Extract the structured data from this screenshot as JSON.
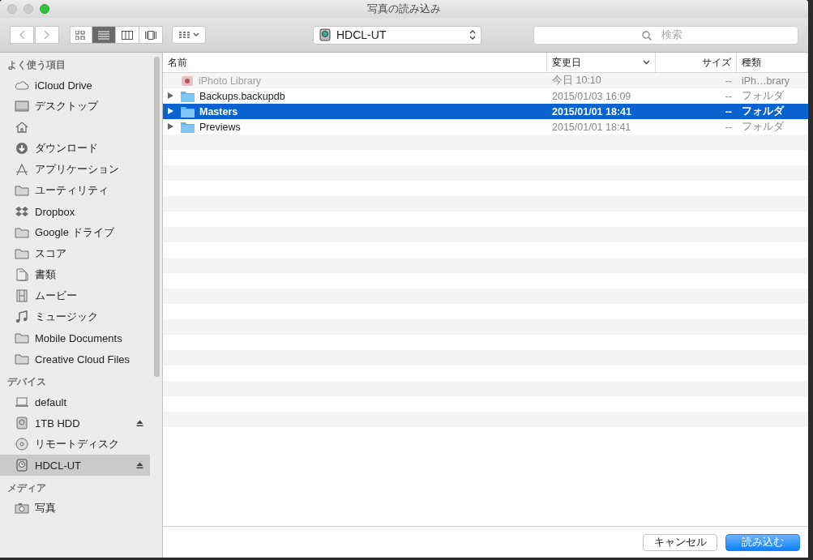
{
  "window": {
    "title": "写真の読み込み"
  },
  "toolbar": {
    "view_modes": [
      {
        "kind": "icons",
        "selected": false
      },
      {
        "kind": "list",
        "selected": true
      },
      {
        "kind": "columns",
        "selected": false
      },
      {
        "kind": "coverflow",
        "selected": false
      }
    ],
    "location": "HDCL-UT",
    "search": {
      "placeholder": "検索"
    }
  },
  "sidebar": {
    "sections": [
      {
        "title": "よく使う項目",
        "items": [
          {
            "kind": "cloud",
            "label": "iCloud Drive",
            "selected": false
          },
          {
            "kind": "desktop",
            "label": "デスクトップ",
            "selected": false
          },
          {
            "kind": "home",
            "selected": false
          },
          {
            "kind": "download",
            "label": "ダウンロード",
            "selected": false
          },
          {
            "kind": "apps",
            "label": "アプリケーション",
            "selected": false
          },
          {
            "kind": "folder",
            "label": "ユーティリティ",
            "selected": false
          },
          {
            "kind": "dropbox",
            "label": "Dropbox",
            "selected": false
          },
          {
            "kind": "folder",
            "label": "Google ドライブ",
            "selected": false
          },
          {
            "kind": "folder",
            "label": "スコア",
            "selected": false
          },
          {
            "kind": "documents",
            "label": "書類",
            "selected": false
          },
          {
            "kind": "film",
            "label": "ムービー",
            "selected": false
          },
          {
            "kind": "music",
            "label": "ミュージック",
            "selected": false
          },
          {
            "kind": "folder",
            "label": "Mobile Documents",
            "selected": false
          },
          {
            "kind": "folder",
            "label": "Creative Cloud Files",
            "selected": false
          }
        ]
      },
      {
        "title": "デバイス",
        "items": [
          {
            "kind": "laptop",
            "label": "default",
            "selected": false,
            "ejectable": false
          },
          {
            "kind": "disk",
            "label": "1TB HDD",
            "selected": false,
            "ejectable": true
          },
          {
            "kind": "optical",
            "label": "リモートディスク",
            "selected": false,
            "ejectable": false
          },
          {
            "kind": "timemachine",
            "label": "HDCL-UT",
            "selected": true,
            "ejectable": true
          }
        ]
      },
      {
        "title": "メディア",
        "items": [
          {
            "kind": "camera",
            "label": "写真",
            "selected": false
          }
        ]
      }
    ]
  },
  "table": {
    "columns": [
      {
        "label": "名前",
        "sorted": false
      },
      {
        "label": "変更日",
        "sorted": true
      },
      {
        "label": "サイズ",
        "sorted": false
      },
      {
        "label": "種類",
        "sorted": false
      }
    ],
    "rows": [
      {
        "kind": "library",
        "name": "iPhoto Library",
        "modified": "今日 10:10",
        "size": "--",
        "type": "iPh…brary",
        "expandable": false,
        "disabled": true,
        "selected": false
      },
      {
        "kind": "folder",
        "name": "Backups.backupdb",
        "modified": "2015/01/03 16:09",
        "size": "--",
        "type": "フォルダ",
        "expandable": true,
        "disabled": false,
        "selected": false
      },
      {
        "kind": "folder",
        "name": "Masters",
        "modified": "2015/01/01 18:41",
        "size": "--",
        "type": "フォルダ",
        "expandable": true,
        "disabled": false,
        "selected": true
      },
      {
        "kind": "folder",
        "name": "Previews",
        "modified": "2015/01/01 18:41",
        "size": "--",
        "type": "フォルダ",
        "expandable": true,
        "disabled": false,
        "selected": false
      }
    ]
  },
  "buttons": [
    {
      "label": "キャンセル",
      "default": false
    },
    {
      "label": "読み込む",
      "default": true
    }
  ]
}
